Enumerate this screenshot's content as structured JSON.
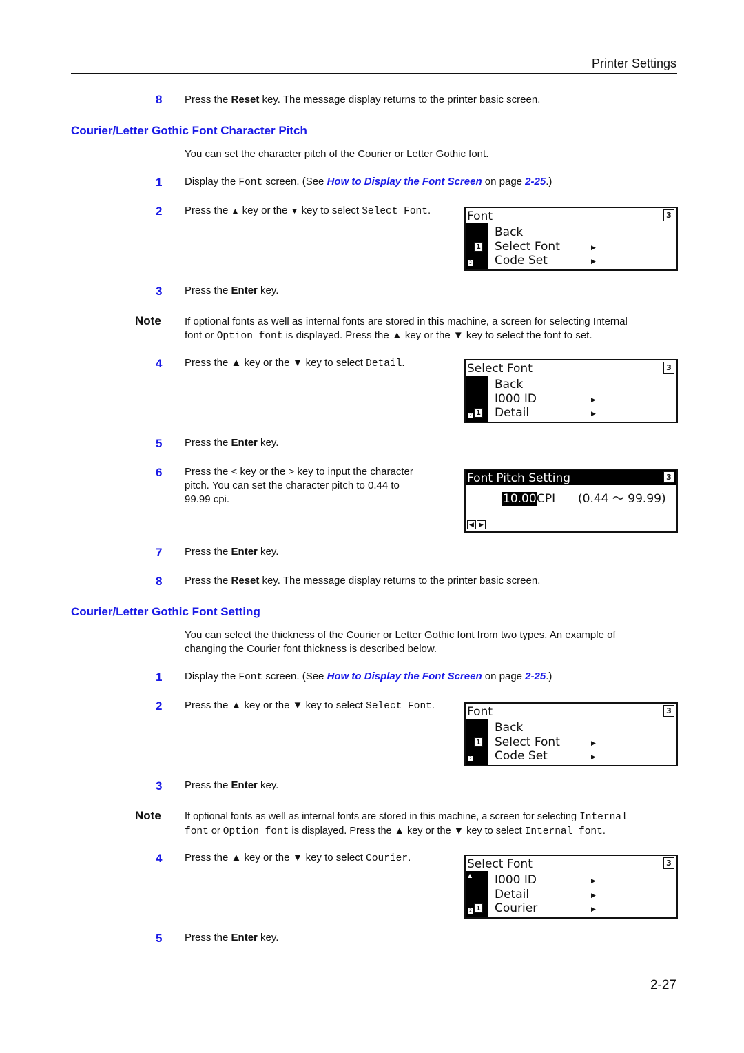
{
  "header": {
    "title": "Printer Settings"
  },
  "intro_step": {
    "num": "8",
    "pre": "Press the ",
    "bold": "Reset",
    "post": " key. The message display returns to the printer basic screen."
  },
  "section1": {
    "title": "Courier/Letter Gothic Font Character Pitch",
    "intro": "You can set the character pitch of the Courier or Letter Gothic font.",
    "step1": {
      "num": "1",
      "pre": "Display the ",
      "mono": "Font",
      "mid": " screen. (See ",
      "link": "How to Display the Font Screen",
      "on": " on page ",
      "page": "2-25",
      "end": ".)"
    },
    "step2": {
      "num": "2",
      "pre": "Press the ",
      "up": "▲",
      "mid": " key or the ",
      "down": "▼",
      "mid2": " key to select ",
      "mono": "Select Font",
      "end": "."
    },
    "step3": {
      "num": "3",
      "pre": "Press the ",
      "bold": "Enter",
      "post": " key."
    },
    "note": {
      "label": "Note",
      "line1": "If optional fonts as well as internal fonts are stored in this machine, a screen for selecting Internal",
      "l2a": "font or ",
      "l2mono": "Option font",
      "l2b": " is displayed. Press the ▲ key or the ▼ key to select the font to set."
    },
    "step4": {
      "num": "4",
      "pre": "Press the ▲ key or the ▼ key to select ",
      "mono": "Detail",
      "end": "."
    },
    "step5": {
      "num": "5",
      "pre": "Press the ",
      "bold": "Enter",
      "post": " key."
    },
    "step6": {
      "num": "6",
      "line1": "Press the < key or the > key to input the character",
      "line2": "pitch. You can set the character pitch to 0.44 to",
      "line3": "99.99 cpi."
    },
    "step7": {
      "num": "7",
      "pre": "Press the ",
      "bold": "Enter",
      "post": " key."
    },
    "step8": {
      "num": "8",
      "pre": "Press the ",
      "bold": "Reset",
      "post": " key. The message display returns to the printer basic screen."
    }
  },
  "section2": {
    "title": "Courier/Letter Gothic Font Setting",
    "intro1": "You can select the thickness of the Courier or Letter Gothic font from two types. An example of",
    "intro2": "changing the Courier font thickness is described below.",
    "step1": {
      "num": "1",
      "pre": "Display the ",
      "mono": "Font",
      "mid": " screen. (See ",
      "link": "How to Display the Font Screen",
      "on": " on page ",
      "page": "2-25",
      "end": ".)"
    },
    "step2": {
      "num": "2",
      "pre": "Press the ▲ key or the ▼ key to select ",
      "mono": "Select Font",
      "end": "."
    },
    "step3": {
      "num": "3",
      "pre": "Press the ",
      "bold": "Enter",
      "post": " key."
    },
    "note": {
      "label": "Note",
      "l1a": "If optional fonts as well as internal fonts are stored in this machine, a screen for selecting ",
      "l1mono": "Internal",
      "l2mono1": "font",
      "l2a": " or ",
      "l2mono2": "Option font",
      "l2b": " is displayed. Press the ▲ key or the ▼ key to select ",
      "l2mono3": "Internal font",
      "l2end": "."
    },
    "step4": {
      "num": "4",
      "pre": "Press the ▲ key or the ▼ key to select ",
      "mono": "Courier",
      "end": "."
    },
    "step5": {
      "num": "5",
      "pre": "Press the ",
      "bold": "Enter",
      "post": " key."
    }
  },
  "lcd1": {
    "title": "Font",
    "tab": "3",
    "rows": [
      "Back",
      "Select Font",
      "Code Set"
    ],
    "selected_index": "1",
    "page_indicator": "2"
  },
  "lcd2": {
    "title": "Select Font",
    "tab": "3",
    "rows": [
      "Back",
      "I000  ID",
      "Detail"
    ],
    "selected_index": "1",
    "page_indicator": "2"
  },
  "lcd3": {
    "title": "Font Pitch Setting",
    "tab": "3",
    "value": "10.00",
    "unit": "CPI",
    "range": "(0.44 ～ 99.99)",
    "left_key": "◀",
    "right_key": "▶"
  },
  "lcd4": {
    "title": "Font",
    "tab": "3",
    "rows": [
      "Back",
      "Select Font",
      "Code Set"
    ],
    "selected_index": "1",
    "page_indicator": "2"
  },
  "lcd5": {
    "title": "Select Font",
    "tab": "3",
    "rows": [
      "I000  ID",
      "Detail",
      "Courier"
    ],
    "selected_index": "1",
    "page_indicator": "2",
    "scroll_up": "▲"
  },
  "page_number": "2-27"
}
